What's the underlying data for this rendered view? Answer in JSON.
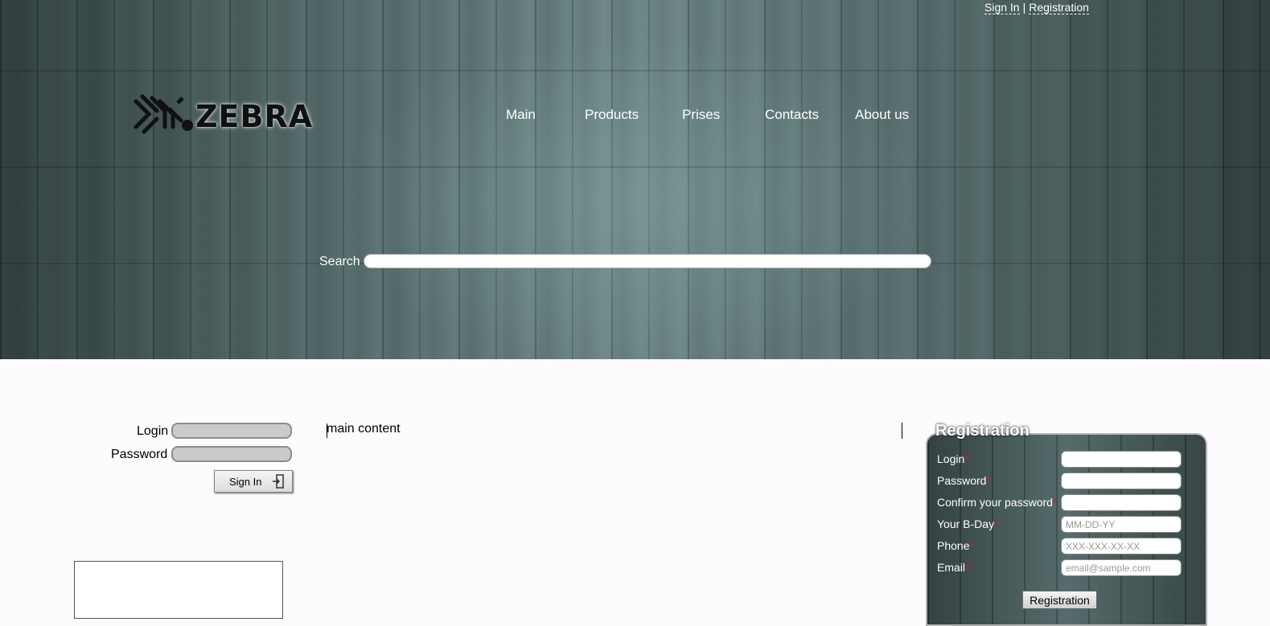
{
  "top_links": {
    "sign_in": "Sign In",
    "separator": "|",
    "registration": "Registration"
  },
  "logo": {
    "text": "ZEBRA"
  },
  "nav": {
    "items": [
      {
        "label": "Main"
      },
      {
        "label": "Products"
      },
      {
        "label": "Prises"
      },
      {
        "label": "Contacts"
      },
      {
        "label": "About us"
      }
    ]
  },
  "search": {
    "label": "Search",
    "value": ""
  },
  "signin": {
    "login_label": "Login",
    "password_label": "Password",
    "button_label": "Sign In"
  },
  "main": {
    "content": "main content"
  },
  "registration": {
    "title": "Registration",
    "required_mark": "*",
    "fields": {
      "login": {
        "label": "Login",
        "placeholder": ""
      },
      "password": {
        "label": "Password",
        "placeholder": ""
      },
      "confirm": {
        "label": "Confirm your password",
        "placeholder": ""
      },
      "bday": {
        "label": "Your B-Day",
        "placeholder": "MM-DD-YY"
      },
      "phone": {
        "label": "Phone",
        "placeholder": "XXX-XXX-XX-XX"
      },
      "email": {
        "label": "Email",
        "placeholder": "email@sample.com"
      }
    },
    "button_label": "Registration"
  }
}
